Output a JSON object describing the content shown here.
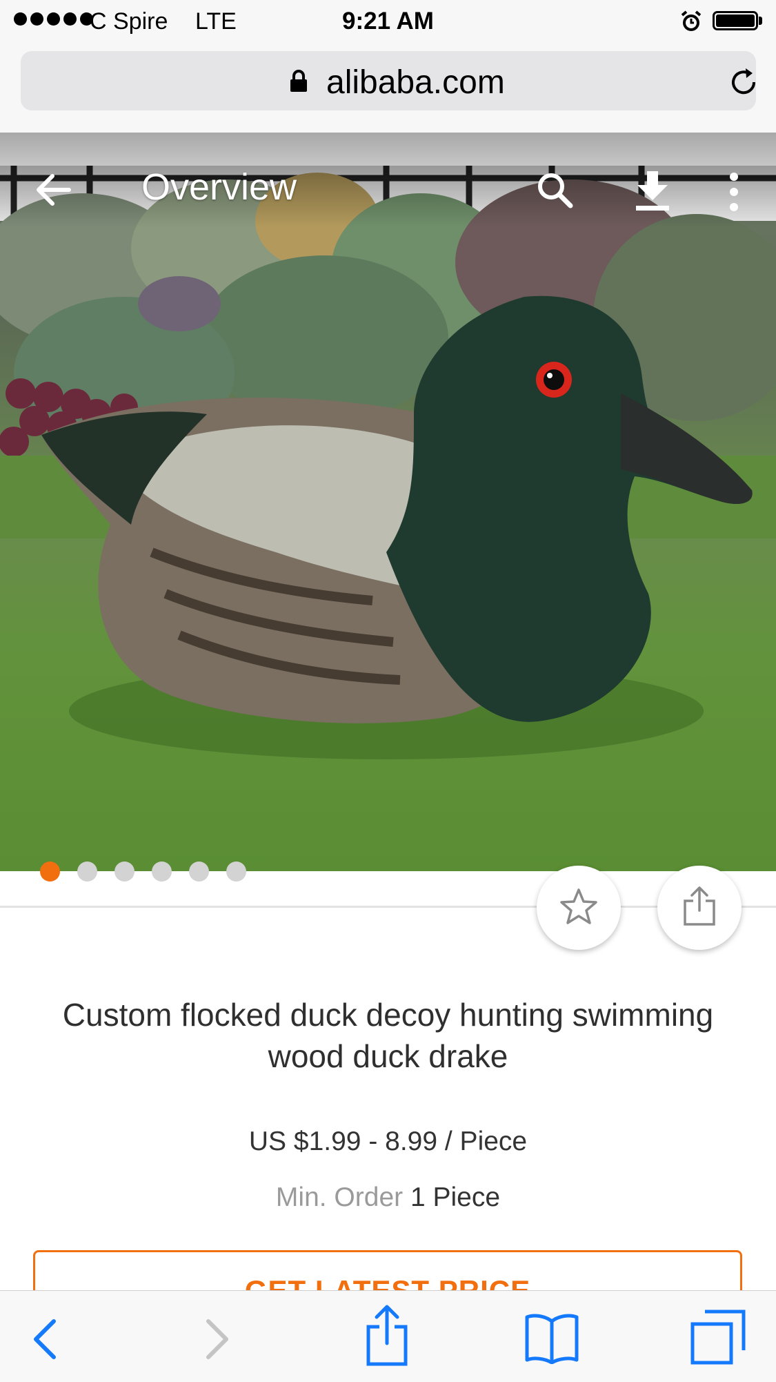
{
  "status_bar": {
    "carrier": "C Spire",
    "network": "LTE",
    "time": "9:21 AM",
    "icons": [
      "signal-dots-icon",
      "alarm-icon",
      "battery-icon"
    ]
  },
  "browser": {
    "url": "alibaba.com",
    "icons": [
      "lock-icon",
      "reload-icon"
    ]
  },
  "header": {
    "title": "Overview",
    "icons": [
      "back-arrow-icon",
      "search-icon",
      "download-icon",
      "more-vertical-icon"
    ]
  },
  "gallery": {
    "image_count": 6,
    "active_index": 0,
    "accent_color": "#f26f0f"
  },
  "actions": {
    "icons": [
      "star-icon",
      "share-icon"
    ]
  },
  "product": {
    "title": "Custom flocked duck decoy hunting swimming wood duck drake",
    "price": "US $1.99 - 8.99 / Piece",
    "min_order_label": "Min. Order",
    "min_order_value": "1 Piece",
    "cta_label": "GET LATEST PRICE"
  },
  "toolbar": {
    "icons": [
      "back-icon",
      "forward-icon",
      "share-icon",
      "bookmarks-icon",
      "tabs-icon"
    ],
    "color": "#1479fb"
  }
}
